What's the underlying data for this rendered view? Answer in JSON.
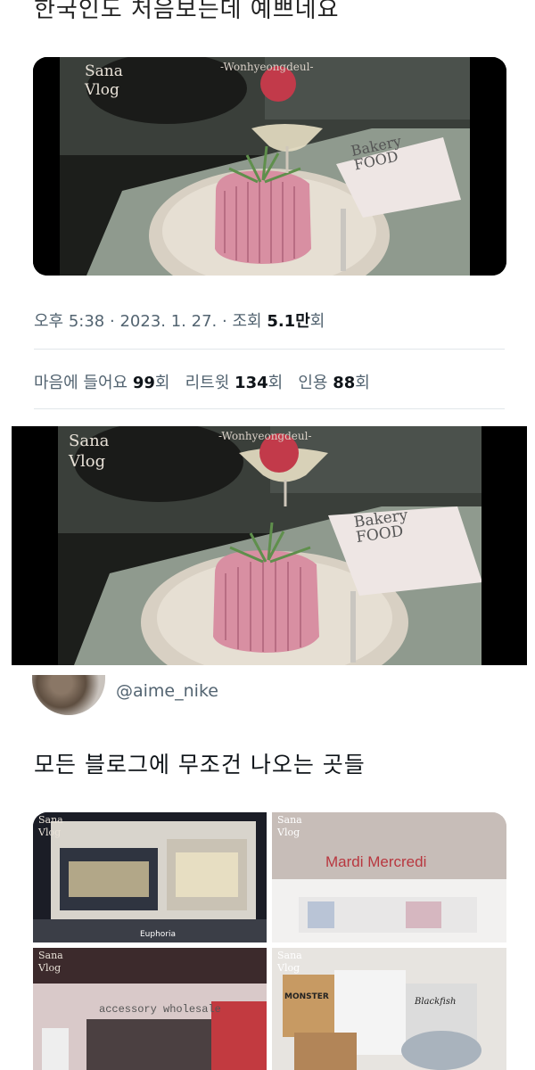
{
  "header": {
    "top_text": "한국인도 처음보는데 예쁘네요"
  },
  "media1": {
    "brand_line1": "Sana",
    "brand_line2": "Vlog",
    "watermark": "-Wonhyeongdeul-",
    "menu_title_1": "Bakery",
    "menu_title_2": "FOOD"
  },
  "tweet_meta": {
    "time": "오후 5:38",
    "date": "2023. 1. 27.",
    "views_label": "조회",
    "views_value": "5.1만",
    "views_suffix": "회",
    "likes_label": "마음에 들어요",
    "likes_value": "99",
    "retweets_label": "리트윗",
    "retweets_value": "134",
    "quotes_label": "인용",
    "quotes_value": "88",
    "count_suffix": "회",
    "sep": "·"
  },
  "media2": {
    "brand_line1": "Sana",
    "brand_line2": "Vlog",
    "watermark": "-Wonhyeongdeul-",
    "menu_title_1": "Bakery",
    "menu_title_2": "FOOD"
  },
  "reply": {
    "handle": "@aime_nike",
    "text": "모든 블로그에 무조건 나오는 곳들"
  },
  "grid": {
    "cell1": {
      "brand_line1": "Sana",
      "brand_line2": "Vlog",
      "caption": "Euphoria"
    },
    "cell2": {
      "brand_line1": "Sana",
      "brand_line2": "Vlog",
      "sign": "Mardi Mercredi"
    },
    "cell3": {
      "brand_line1": "Sana",
      "brand_line2": "Vlog",
      "sign": "accessory wholesale"
    },
    "cell4": {
      "brand_line1": "Sana",
      "brand_line2": "Vlog",
      "bag1": "MONSTER",
      "bag2": "Blackfish"
    }
  }
}
